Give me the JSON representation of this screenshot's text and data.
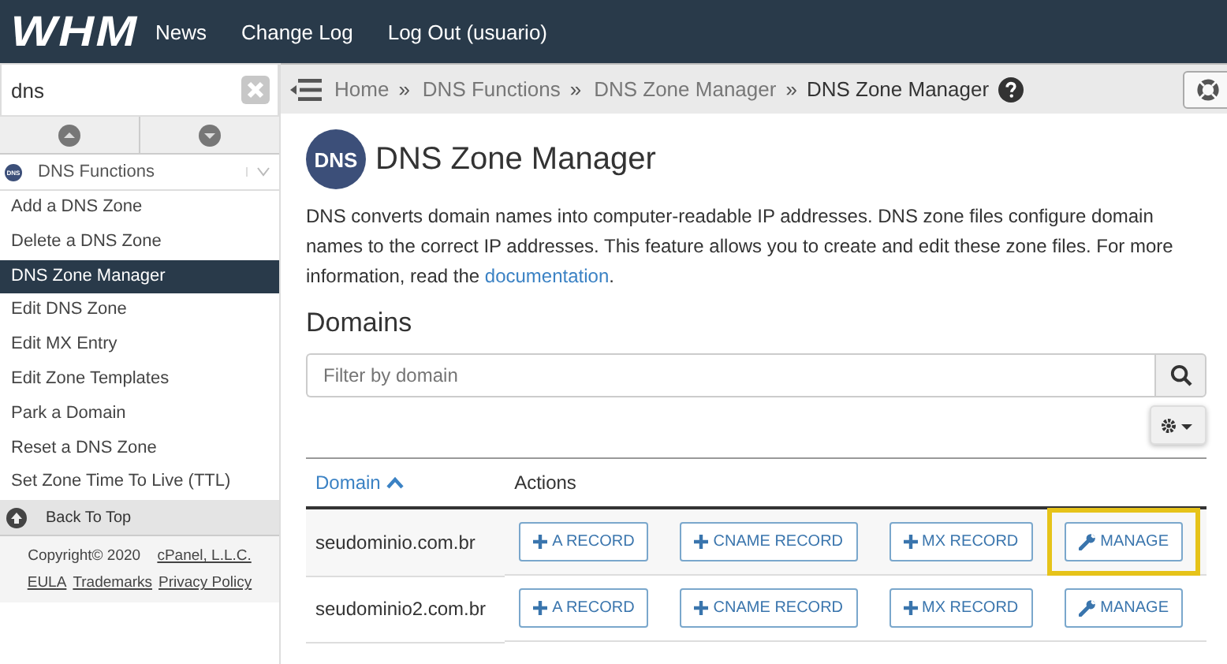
{
  "header": {
    "logo": "WHM",
    "nav": [
      "News",
      "Change Log",
      "Log Out (usuario)"
    ]
  },
  "sidebar": {
    "search": {
      "value": "dns"
    },
    "group": {
      "logo": "DNS",
      "label": "DNS Functions"
    },
    "items": [
      {
        "label": "Add a DNS Zone",
        "selected": false
      },
      {
        "label": "Delete a DNS Zone",
        "selected": false
      },
      {
        "label": "DNS Zone Manager",
        "selected": true
      },
      {
        "label": "Edit DNS Zone",
        "selected": false
      },
      {
        "label": "Edit MX Entry",
        "selected": false
      },
      {
        "label": "Edit Zone Templates",
        "selected": false
      },
      {
        "label": "Park a Domain",
        "selected": false
      },
      {
        "label": "Reset a DNS Zone",
        "selected": false
      },
      {
        "label": "Set Zone Time To Live (TTL)",
        "selected": false
      }
    ],
    "back_to_top": "Back To Top",
    "footer": {
      "copyright": "Copyright© 2020",
      "company": "cPanel, L.L.C.",
      "links": [
        "EULA",
        "Trademarks",
        "Privacy Policy"
      ]
    }
  },
  "breadcrumb": {
    "items": [
      "Home",
      "DNS Functions",
      "DNS Zone Manager"
    ],
    "current": "DNS Zone Manager",
    "separator": "»"
  },
  "page": {
    "logo": "DNS",
    "title": "DNS Zone Manager",
    "description": "DNS converts domain names into computer-readable IP addresses. DNS zone files configure domain names to the correct IP addresses. This feature allows you to create and edit these zone files. For more information, read the",
    "link": "documentation",
    "description_end": ".",
    "section": "Domains",
    "filter": {
      "placeholder": "Filter by domain"
    }
  },
  "table": {
    "columns": [
      {
        "label": "Domain",
        "sorted": true
      },
      {
        "label": "Actions",
        "sorted": false
      }
    ],
    "rows": [
      {
        "domain": "seudominio.com.br",
        "actions": [
          {
            "kind": "add",
            "label": "A RECORD",
            "highlighted": false
          },
          {
            "kind": "add",
            "label": "CNAME RECORD",
            "highlighted": false
          },
          {
            "kind": "add",
            "label": "MX RECORD",
            "highlighted": false
          },
          {
            "kind": "manage",
            "label": "MANAGE",
            "highlighted": true
          }
        ]
      },
      {
        "domain": "seudominio2.com.br",
        "actions": [
          {
            "kind": "add",
            "label": "A RECORD",
            "highlighted": false
          },
          {
            "kind": "add",
            "label": "CNAME RECORD",
            "highlighted": false
          },
          {
            "kind": "add",
            "label": "MX RECORD",
            "highlighted": false
          },
          {
            "kind": "manage",
            "label": "MANAGE",
            "highlighted": false
          }
        ]
      }
    ]
  }
}
